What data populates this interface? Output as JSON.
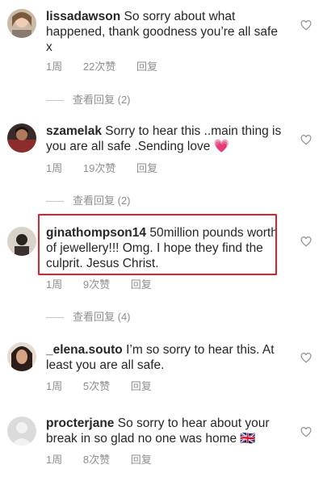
{
  "comments": [
    {
      "username": "lissadawson",
      "text": "So sorry about what happened, thank goodness you’re all safe x",
      "time": "1周",
      "likes": "22次赞",
      "reply_label": "回复",
      "view_replies": "查看回复 (2)",
      "avatar_icon": "profile-photo-icon"
    },
    {
      "username": "szamelak",
      "text": "Sorry to hear this ..main thing is you are all safe .Sending love 💗",
      "time": "1周",
      "likes": "19次赞",
      "reply_label": "回复",
      "view_replies": "查看回复 (2)",
      "avatar_icon": "profile-photo-icon"
    },
    {
      "username": "ginathompson14",
      "text": "50million pounds worth of jewellery!!! Omg. I  hope they find the culprit. Jesus Christ.",
      "time": "1周",
      "likes": "9次赞",
      "reply_label": "回复",
      "view_replies": "查看回复 (4)",
      "avatar_icon": "profile-photo-icon"
    },
    {
      "username": "_elena.souto",
      "text": "I’m so sorry to hear this. At least you are all safe.",
      "time": "1周",
      "likes": "5次赞",
      "reply_label": "回复",
      "avatar_icon": "profile-photo-icon"
    },
    {
      "username": "procterjane",
      "text": "So sorry to hear about your break in so glad no one was home 🇬🇧",
      "time": "1周",
      "likes": "8次赞",
      "reply_label": "回复",
      "avatar_icon": "default-avatar-icon"
    }
  ],
  "colors": {
    "highlight_border": "#e0202a",
    "muted_text": "#8e8e8e",
    "primary_text": "#262626"
  },
  "like_icon": "heart-outline-icon"
}
